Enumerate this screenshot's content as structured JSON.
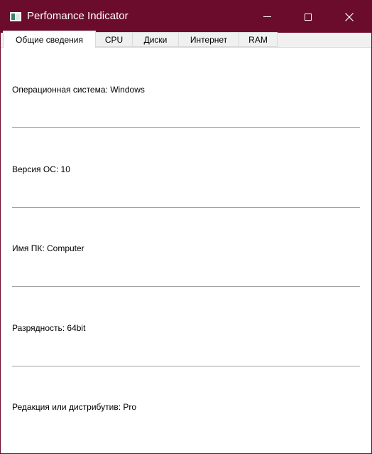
{
  "window": {
    "title": "Perfomance Indicator",
    "title_bar_color": "#6b0c2c"
  },
  "icons": {
    "app": "app-window-icon",
    "minimize": "minimize-icon",
    "maximize": "maximize-icon",
    "close": "close-icon"
  },
  "tabs": [
    {
      "label": "Общие сведения",
      "active": true
    },
    {
      "label": "CPU",
      "active": false
    },
    {
      "label": "Диски",
      "active": false
    },
    {
      "label": "Интернет",
      "active": false
    },
    {
      "label": "RAM",
      "active": false
    }
  ],
  "info": [
    {
      "label": "Операционная система: Windows"
    },
    {
      "label": "Версия ОС: 10"
    },
    {
      "label": "Имя ПК: Computer"
    },
    {
      "label": "Разрядность: 64bit"
    },
    {
      "label": "Редакция или дистрибутив: Pro"
    }
  ]
}
